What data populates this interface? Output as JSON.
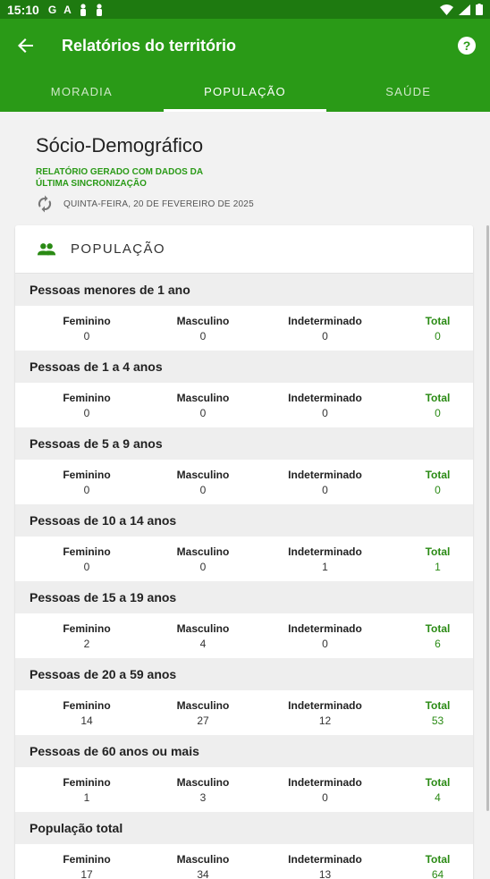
{
  "status": {
    "time": "15:10",
    "icons": [
      "G",
      "A",
      "person",
      "person"
    ]
  },
  "app_bar": {
    "title": "Relatórios do território"
  },
  "tabs": [
    {
      "label": "MORADIA",
      "active": false
    },
    {
      "label": "POPULAÇÃO",
      "active": true
    },
    {
      "label": "SAÚDE",
      "active": false
    }
  ],
  "header": {
    "title": "Sócio-Demográfico",
    "subtitle": "RELATÓRIO GERADO COM DADOS DA ÚLTIMA SINCRONIZAÇÃO",
    "date": "QUINTA-FEIRA, 20 DE FEVEREIRO DE 2025"
  },
  "card": {
    "title": "POPULAÇÃO"
  },
  "columns": {
    "f": "Feminino",
    "m": "Masculino",
    "i": "Indeterminado",
    "t": "Total"
  },
  "sections": [
    {
      "label": "Pessoas menores de 1 ano",
      "values": [
        "0",
        "0",
        "0",
        "0"
      ]
    },
    {
      "label": "Pessoas de 1 a 4 anos",
      "values": [
        "0",
        "0",
        "0",
        "0"
      ]
    },
    {
      "label": "Pessoas de 5 a 9 anos",
      "values": [
        "0",
        "0",
        "0",
        "0"
      ]
    },
    {
      "label": "Pessoas de 10 a 14 anos",
      "values": [
        "0",
        "0",
        "1",
        "1"
      ]
    },
    {
      "label": "Pessoas de 15 a 19 anos",
      "values": [
        "2",
        "4",
        "0",
        "6"
      ]
    },
    {
      "label": "Pessoas de 20 a 59 anos",
      "values": [
        "14",
        "27",
        "12",
        "53"
      ]
    },
    {
      "label": "Pessoas de 60 anos ou mais",
      "values": [
        "1",
        "3",
        "0",
        "4"
      ]
    },
    {
      "label": "População total",
      "values": [
        "17",
        "34",
        "13",
        "64"
      ]
    }
  ],
  "colors": {
    "appbar": "#2a9a17",
    "statusbar": "#1e7a10",
    "accent": "#2a8a14"
  }
}
